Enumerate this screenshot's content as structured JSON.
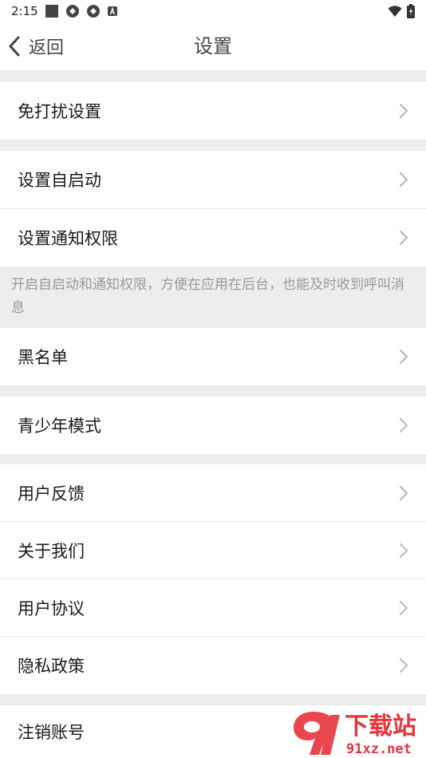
{
  "status_bar": {
    "time": "2:15"
  },
  "nav": {
    "back_label": "返回",
    "title": "设置"
  },
  "menu": {
    "do_not_disturb": "免打扰设置",
    "auto_start": "设置自启动",
    "notification_permission": "设置通知权限",
    "hint": "开启自启动和通知权限，方便在应用在后台，也能及时收到呼叫消息",
    "blacklist": "黑名单",
    "youth_mode": "青少年模式",
    "feedback": "用户反馈",
    "about_us": "关于我们",
    "user_agreement": "用户协议",
    "privacy_policy": "隐私政策",
    "delete_account": "注销账号"
  },
  "watermark": {
    "brand": "下载站",
    "domain": "91xz.net"
  },
  "colors": {
    "background": "#ededed",
    "surface": "#ffffff",
    "hint_text": "#9a9a9a",
    "chevron": "#b5b5b5",
    "watermark": "#e8323c"
  }
}
